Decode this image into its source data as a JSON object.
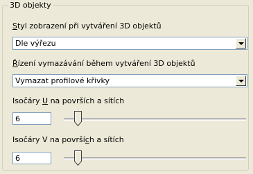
{
  "group": {
    "title": "3D objekty"
  },
  "display_style": {
    "label_pre": "",
    "label_key": "S",
    "label_post": "tyl zobrazení při vytváření 3D objektů",
    "value": "Dle výřezu"
  },
  "deletion_control": {
    "label_pre": "",
    "label_key": "Ř",
    "label_post": "ízení vymazávání během vytváření 3D objektů",
    "value": "Vymazat profilové křivky"
  },
  "isolines_u": {
    "label_pre": "Isočáry ",
    "label_key": "U",
    "label_post": " na površích a sítích",
    "value": "6",
    "slider_fraction": 0.06
  },
  "isolines_v": {
    "label_pre": "Isočáry V na površí",
    "label_key": "c",
    "label_post": "h a sítích",
    "value": "6",
    "slider_fraction": 0.06
  },
  "icons": {
    "dropdown": "chevron-down-icon",
    "slider": "slider-thumb-icon"
  }
}
